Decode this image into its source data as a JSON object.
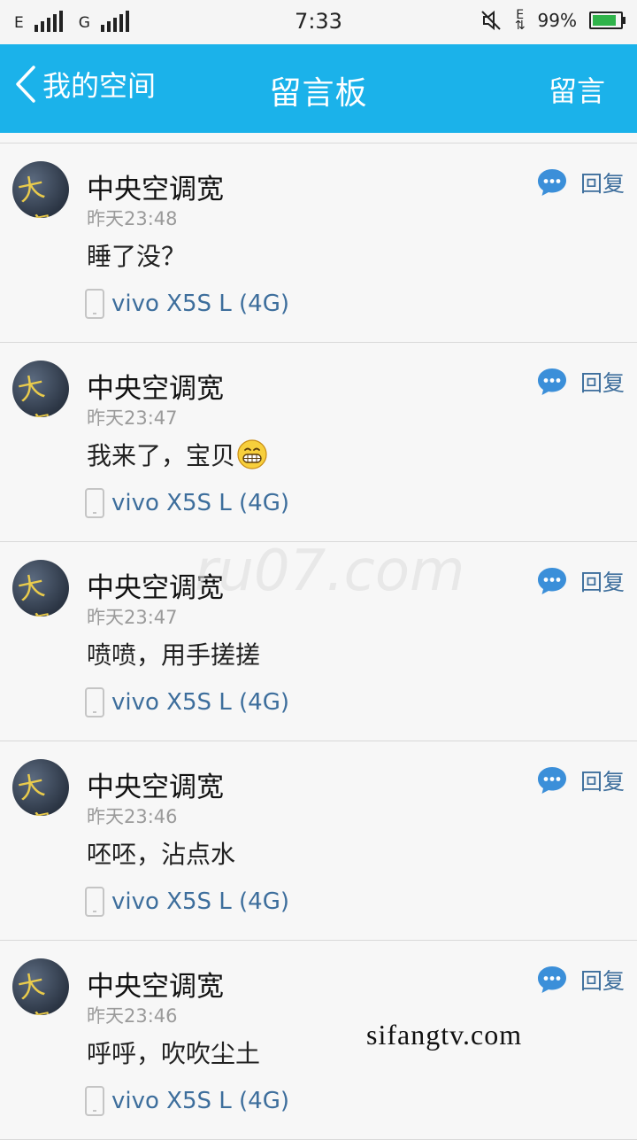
{
  "status_bar": {
    "carrier1": "E",
    "carrier2": "G",
    "time": "7:33",
    "data_label": "E",
    "battery": "99%",
    "battery_level": 0.99,
    "battery_color": "#2fb34a"
  },
  "header": {
    "back_label": "我的空间",
    "title": "留言板",
    "action_label": "留言",
    "background": "#1bb2ea"
  },
  "messages": [
    {
      "name": "中央空调宽",
      "time": "昨天23:48",
      "content": "睡了没？",
      "emoji": "",
      "device": "vivo X5S L (4G)",
      "reply": "回复",
      "avatar_text": "大宽"
    },
    {
      "name": "中央空调宽",
      "time": "昨天23:47",
      "content": "我来了，宝贝",
      "emoji": "grin",
      "device": "vivo X5S L (4G)",
      "reply": "回复",
      "avatar_text": "大宽"
    },
    {
      "name": "中央空调宽",
      "time": "昨天23:47",
      "content": "喷喷，用手搓搓",
      "emoji": "",
      "device": "vivo X5S L (4G)",
      "reply": "回复",
      "avatar_text": "大宽"
    },
    {
      "name": "中央空调宽",
      "time": "昨天23:46",
      "content": "呸呸，沾点水",
      "emoji": "",
      "device": "vivo X5S L (4G)",
      "reply": "回复",
      "avatar_text": "大宽"
    },
    {
      "name": "中央空调宽",
      "time": "昨天23:46",
      "content": "呼呼，吹吹尘土",
      "emoji": "",
      "device": "vivo X5S L (4G)",
      "reply": "回复",
      "avatar_text": "大宽"
    }
  ],
  "watermarks": {
    "center": "ru07.com",
    "bottom": "sifangtv.com"
  }
}
